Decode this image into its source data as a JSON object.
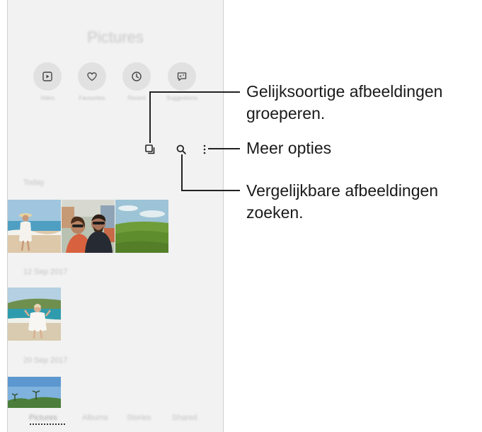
{
  "app": {
    "title": "Pictures"
  },
  "shortcuts": [
    {
      "label": "Video",
      "icon": "video-icon"
    },
    {
      "label": "Favourites",
      "icon": "heart-icon"
    },
    {
      "label": "Recent",
      "icon": "clock-icon"
    },
    {
      "label": "Suggestions",
      "icon": "suggestion-icon"
    }
  ],
  "toolbar": {
    "group_icon": "group-similar-icon",
    "search_icon": "search-icon",
    "more_icon": "more-options-icon"
  },
  "sections": [
    {
      "date": "Today"
    },
    {
      "date": "12 Sep 2017"
    },
    {
      "date": "20 Sep 2017"
    }
  ],
  "tabs": [
    {
      "label": "Pictures"
    },
    {
      "label": "Albums"
    },
    {
      "label": "Stories"
    },
    {
      "label": "Shared"
    }
  ],
  "callouts": {
    "group": [
      "Gelijksoortige afbeeldingen",
      "groeperen."
    ],
    "more": "Meer opties",
    "search": [
      "Vergelijkbare afbeeldingen",
      "zoeken."
    ]
  }
}
